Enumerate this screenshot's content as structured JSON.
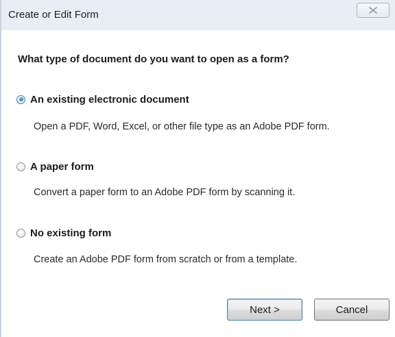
{
  "window": {
    "title": "Create or Edit Form",
    "close_icon": "close-x-icon"
  },
  "question": "What type of document do you want to open as a form?",
  "options": [
    {
      "label": "An existing electronic document",
      "description": "Open a PDF, Word, Excel, or other file type as an Adobe PDF form.",
      "selected": true
    },
    {
      "label": "A paper form",
      "description": "Convert a paper form to an Adobe PDF form by scanning it.",
      "selected": false
    },
    {
      "label": "No existing form",
      "description": "Create an Adobe PDF form from scratch or from a template.",
      "selected": false
    }
  ],
  "buttons": {
    "next_label": "Next >",
    "cancel_label": "Cancel"
  },
  "colors": {
    "accent": "#3c7fb1",
    "titlebar": "#e9eef4"
  }
}
